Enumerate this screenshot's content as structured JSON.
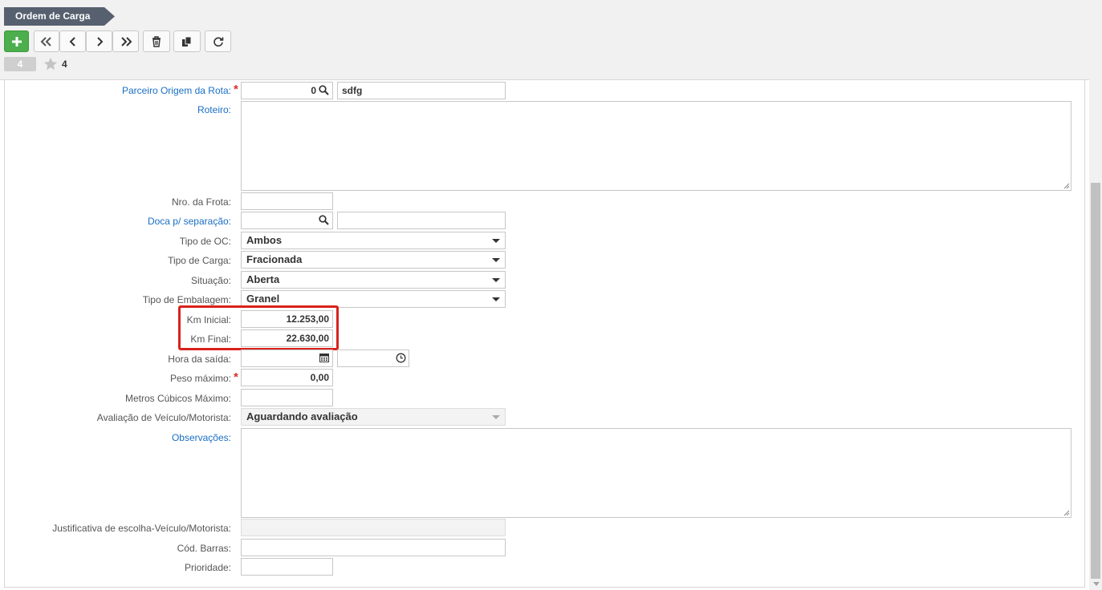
{
  "header": {
    "breadcrumb": "Ordem de Carga",
    "record_badge": "4",
    "favorites_count": "4",
    "toolbar": [
      {
        "icon": "plus-icon"
      },
      {
        "icon": "first-record-icon"
      },
      {
        "icon": "previous-record-icon"
      },
      {
        "icon": "next-record-icon"
      },
      {
        "icon": "last-record-icon"
      },
      {
        "icon": "trash-icon"
      },
      {
        "icon": "copy-icon"
      },
      {
        "icon": "refresh-icon"
      }
    ]
  },
  "form": {
    "parceiro_origem": {
      "label": "Parceiro Origem da Rota:",
      "code": "0",
      "name": "sdfg"
    },
    "roteiro": {
      "label": "Roteiro:",
      "value": ""
    },
    "nro_frota": {
      "label": "Nro. da Frota:",
      "value": ""
    },
    "doca": {
      "label": "Doca p/ separação:",
      "code": "",
      "name": ""
    },
    "tipo_oc": {
      "label": "Tipo de OC:",
      "value": "Ambos"
    },
    "tipo_carga": {
      "label": "Tipo de Carga:",
      "value": "Fracionada"
    },
    "situacao": {
      "label": "Situação:",
      "value": "Aberta"
    },
    "tipo_embalagem": {
      "label": "Tipo de Embalagem:",
      "value": "Granel"
    },
    "km_inicial": {
      "label": "Km Inicial:",
      "value": "12.253,00"
    },
    "km_final": {
      "label": "Km Final:",
      "value": "22.630,00"
    },
    "hora_saida": {
      "label": "Hora da saída:",
      "date": "",
      "time": ""
    },
    "peso_maximo": {
      "label": "Peso máximo:",
      "value": "0,00"
    },
    "metros_cubicos": {
      "label": "Metros Cúbicos Máximo:",
      "value": ""
    },
    "avaliacao": {
      "label": "Avaliação de Veículo/Motorista:",
      "value": "Aguardando avaliação"
    },
    "observacoes": {
      "label": "Observações:",
      "value": ""
    },
    "justificativa": {
      "label": "Justificativa de escolha-Veículo/Motorista:",
      "value": ""
    },
    "cod_barras": {
      "label": "Cód. Barras:",
      "value": ""
    },
    "prioridade": {
      "label": "Prioridade:",
      "value": ""
    }
  },
  "colors": {
    "link_label": "#1a6fc4",
    "required_asterisk": "#d9302c",
    "highlight_border": "#d9221c",
    "add_button": "#4cae4c",
    "breadcrumb_bg": "#56606f"
  }
}
